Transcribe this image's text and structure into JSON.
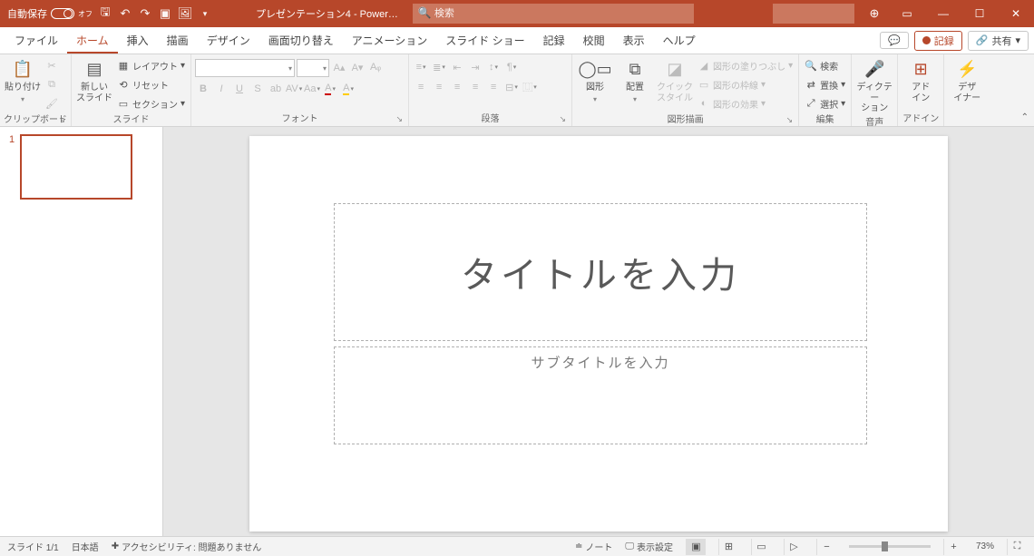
{
  "titlebar": {
    "autosave_label": "自動保存",
    "autosave_state": "オフ",
    "doc_title": "プレゼンテーション4 - Power…",
    "search_placeholder": "検索"
  },
  "tabs": {
    "file": "ファイル",
    "home": "ホーム",
    "insert": "挿入",
    "draw": "描画",
    "design": "デザイン",
    "transitions": "画面切り替え",
    "animations": "アニメーション",
    "slideshow": "スライド ショー",
    "record": "記録",
    "review": "校閲",
    "view": "表示",
    "help": "ヘルプ",
    "rec_btn": "記録",
    "share_btn": "共有"
  },
  "ribbon": {
    "clipboard": {
      "paste": "貼り付け",
      "label": "クリップボード"
    },
    "slides": {
      "new_slide": "新しい\nスライド",
      "layout": "レイアウト",
      "reset": "リセット",
      "section": "セクション",
      "label": "スライド"
    },
    "font": {
      "label": "フォント"
    },
    "paragraph": {
      "label": "段落"
    },
    "drawing": {
      "shapes": "図形",
      "arrange": "配置",
      "quick_styles": "クイック\nスタイル",
      "shape_fill": "図形の塗りつぶし",
      "shape_outline": "図形の枠線",
      "shape_effects": "図形の効果",
      "label": "図形描画"
    },
    "editing": {
      "find": "検索",
      "replace": "置換",
      "select": "選択",
      "label": "編集"
    },
    "voice": {
      "dictate": "ディクテー\nション",
      "label": "音声"
    },
    "addins": {
      "addins": "アド\nイン",
      "label": "アドイン"
    },
    "designer": {
      "designer": "デザ\nイナー"
    }
  },
  "slide": {
    "title_placeholder": "タイトルを入力",
    "subtitle_placeholder": "サブタイトルを入力"
  },
  "thumbs": {
    "n1": "1"
  },
  "status": {
    "slide_counter": "スライド 1/1",
    "language": "日本語",
    "accessibility": "アクセシビリティ: 問題ありません",
    "notes": "ノート",
    "display_settings": "表示設定",
    "zoom": "73%"
  }
}
